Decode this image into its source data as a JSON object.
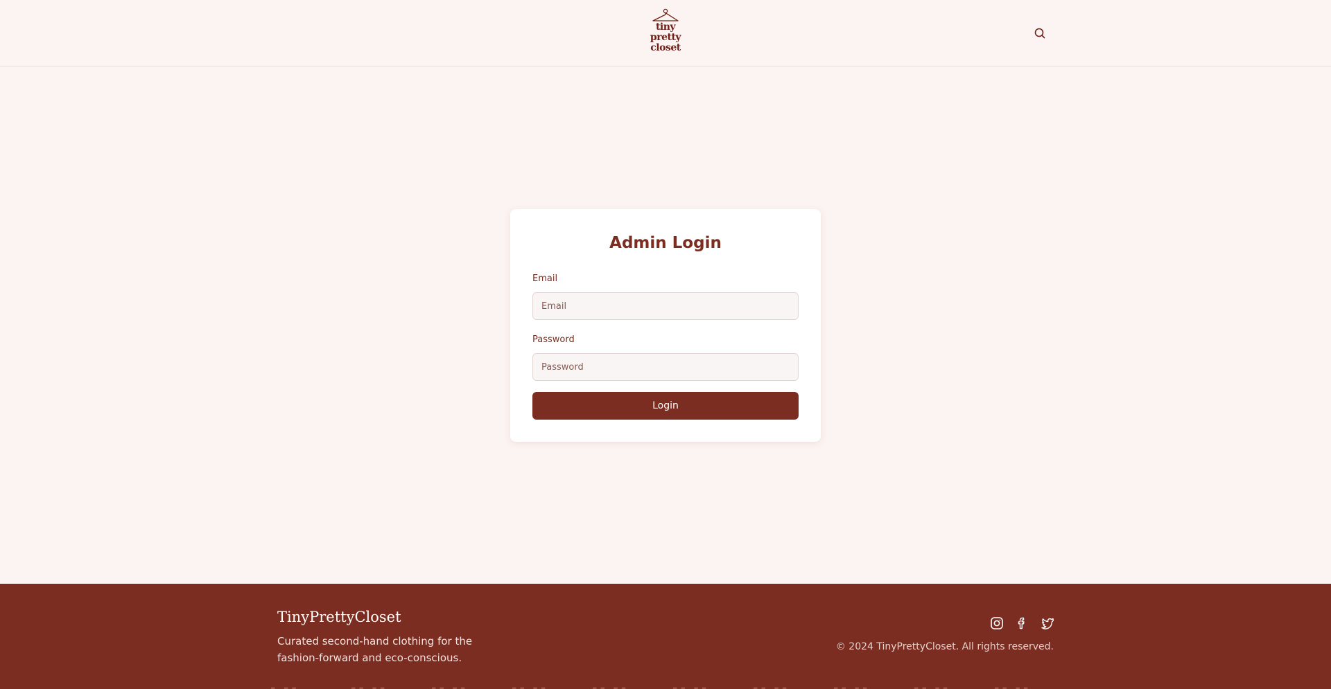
{
  "header": {
    "logo_text": [
      "tiny",
      "pretty",
      "closet"
    ],
    "search_icon": "search-icon"
  },
  "login": {
    "title": "Admin Login",
    "email_label": "Email",
    "email_placeholder": "Email",
    "email_value": "",
    "password_label": "Password",
    "password_placeholder": "Password",
    "password_value": "",
    "button_label": "Login"
  },
  "footer": {
    "brand": "TinyPrettyCloset",
    "tagline": "Curated second-hand clothing for the fashion-forward and eco-conscious.",
    "copyright": "© 2024 TinyPrettyCloset. All rights reserved.",
    "social_icons": [
      "instagram-icon",
      "facebook-icon",
      "twitter-icon"
    ]
  },
  "colors": {
    "brand": "#7b2d22",
    "background": "#fcf4f2",
    "card": "#ffffff"
  }
}
